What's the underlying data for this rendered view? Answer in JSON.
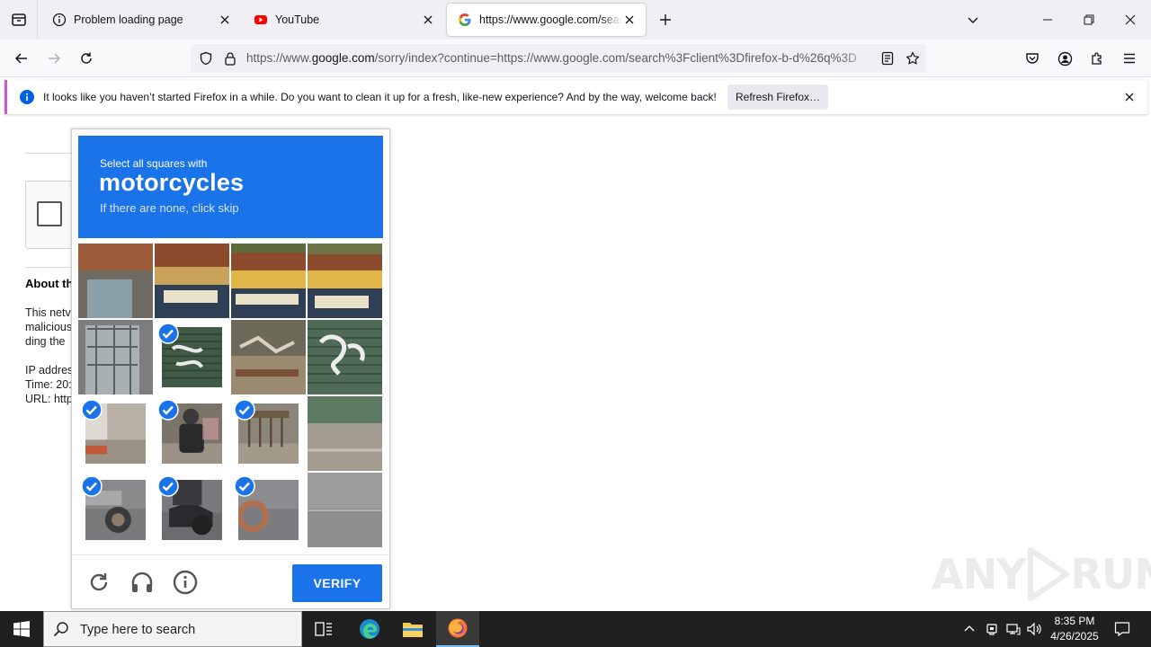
{
  "browser": {
    "tabs": [
      {
        "title": "Problem loading page",
        "icon": "info-circle-icon",
        "active": false
      },
      {
        "title": "YouTube",
        "icon": "youtube-icon",
        "active": false
      },
      {
        "title": "https://www.google.com/search",
        "icon": "google-icon",
        "active": true
      }
    ],
    "url_prefix": "https://www.",
    "url_host": "google.com",
    "url_rest": "/sorry/index?continue=https://www.google.com/search%3Fclient%3Dfirefox-b-d%26q%3D"
  },
  "notification": {
    "message": "It looks like you haven’t started Firefox in a while. Do you want to clean it up for a fresh, like-new experience? And by the way, welcome back!",
    "button": "Refresh Firefox…"
  },
  "page": {
    "about_heading": "About th",
    "about_lines": [
      "This netv",
      "malicious",
      "ding the",
      "",
      "IP addres",
      "Time: 20:",
      "URL: http"
    ]
  },
  "captcha": {
    "instruction": "Select all squares with",
    "object": "motorcycles",
    "hint": "If there are none, click skip",
    "verify_label": "VERIFY",
    "selected_cells": [
      5,
      8,
      9,
      10,
      12,
      13,
      14
    ],
    "accent_color": "#1a73e8"
  },
  "watermark": {
    "text_left": "ANY",
    "text_right": "RUN"
  },
  "taskbar": {
    "search_placeholder": "Type here to search",
    "time": "8:35 PM",
    "date": "4/26/2025"
  }
}
